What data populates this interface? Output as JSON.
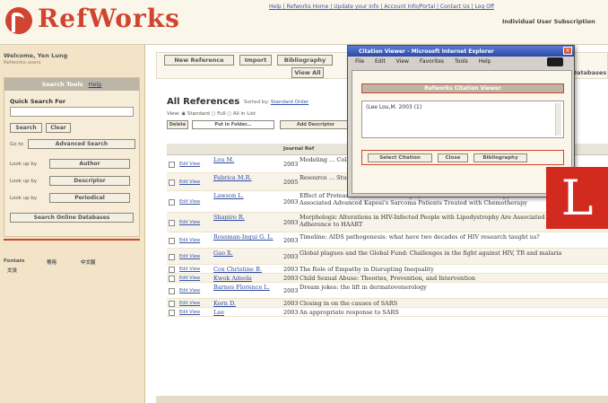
{
  "header": {
    "app_name": "RefWorks",
    "top_links": "Help | Refworks Home | Update your info | Account Info/Portal | Contact Us | Log Off",
    "subscription": "Individual User Subscription"
  },
  "sidebar": {
    "welcome": "Welcome, Yen Lung",
    "welcome_sub": "Refworks users",
    "search_tools": "Search Tools",
    "search_tools_help": "Help",
    "quick_search_label": "Quick Search For",
    "search_button": "Search",
    "clear_button": "Clear",
    "advanced_label": "Go to",
    "advanced_search_button": "Advanced Search",
    "lookup_label": "Look up by",
    "author_button": "Author",
    "descriptor_button": "Descriptor",
    "periodical_button": "Periodical",
    "online_db_button": "Search Online Databases",
    "foot_left": "Fontain",
    "foot_left2": "文法",
    "foot_mid": "常用",
    "foot_right": "中文版"
  },
  "toolbar": {
    "new_reference": "New Reference",
    "import": "Import",
    "bibliography": "Bibliography",
    "view_all": "View All",
    "databases": "Databases"
  },
  "main": {
    "title": "All References",
    "sort_label": "Sorted by:",
    "sort_value": "Standard Order",
    "options": "View: ◉ Standard ○ Full ○ All in List",
    "opt_delete": "Delete",
    "opt_folder": "Put in Folder...",
    "opt_add": "Add Descriptor",
    "table_header": "Journal Ref"
  },
  "rows": [
    {
      "links": "Edit View",
      "author": "Lou M.",
      "year": "2003",
      "title": "Modeling ... Collection ..."
    },
    {
      "links": "Edit View",
      "author": "Fabrica M.R.",
      "year": "2005",
      "title": "Resource ... Study of ..."
    },
    {
      "links": "Edit View",
      "author": "Lawson L.",
      "year": "2003",
      "title": "Effect of Protease Inhibitor-Based Highly Active Antiretroviral Therapy on Survival in HIV-Associated Advanced Kaposi's Sarcoma Patients Treated with Chemotherapy"
    },
    {
      "links": "Edit View",
      "author": "Shapiro R.",
      "year": "2003",
      "title": "Morphologic Alterations in HIV-Infected People with Lipodystrophy Are Associated with Good Adherence to HAART"
    },
    {
      "links": "Edit View",
      "author": "Rossman-Ingui G. L.",
      "year": "2003",
      "title": "Timeline: AIDS pathogenesis: what have two decades of HIV research taught us?"
    },
    {
      "links": "Edit View",
      "author": "Gao X.",
      "year": "2003",
      "title": "Global plagues and the Global Fund: Challenges in the fight against HIV, TB and malaria"
    },
    {
      "links": "Edit View",
      "author": "Cox Christine B.",
      "year": "2003",
      "title": "The Role of Empathy in Disrupting Inequality"
    },
    {
      "links": "Edit View",
      "author": "Kwok Adeola",
      "year": "2003",
      "title": "Child Sexual Abuse: Theories, Prevention, and Intervention"
    },
    {
      "links": "Edit View",
      "author": "Barnes Florence L.",
      "year": "2003",
      "title": "Dream jokes: the lift in dermatovenerology"
    },
    {
      "links": "Edit View",
      "author": "Korn D.",
      "year": "2003",
      "title": "Closing in on the causes of SARS"
    },
    {
      "links": "Edit View",
      "author": "Lee",
      "year": "2003",
      "title": "An appropriate response to SARS"
    }
  ],
  "popup": {
    "window_title": "Citation Viewer - Microsoft Internet Explorer",
    "menu": [
      "File",
      "Edit",
      "View",
      "Favorites",
      "Tools",
      "Help"
    ],
    "heading": "Refworks Citation Viewer",
    "citation_text": "(Lee Lou,M. 2003 (1)",
    "select_button": "Select Citation",
    "close_button": "Close",
    "bibliography_button": "Bibliography"
  },
  "badge": {
    "letter": "L",
    "color": "#d32a1f"
  },
  "colors": {
    "brand": "#d0452f",
    "link": "#3a55a3",
    "sidebar": "#f3e4c8"
  }
}
